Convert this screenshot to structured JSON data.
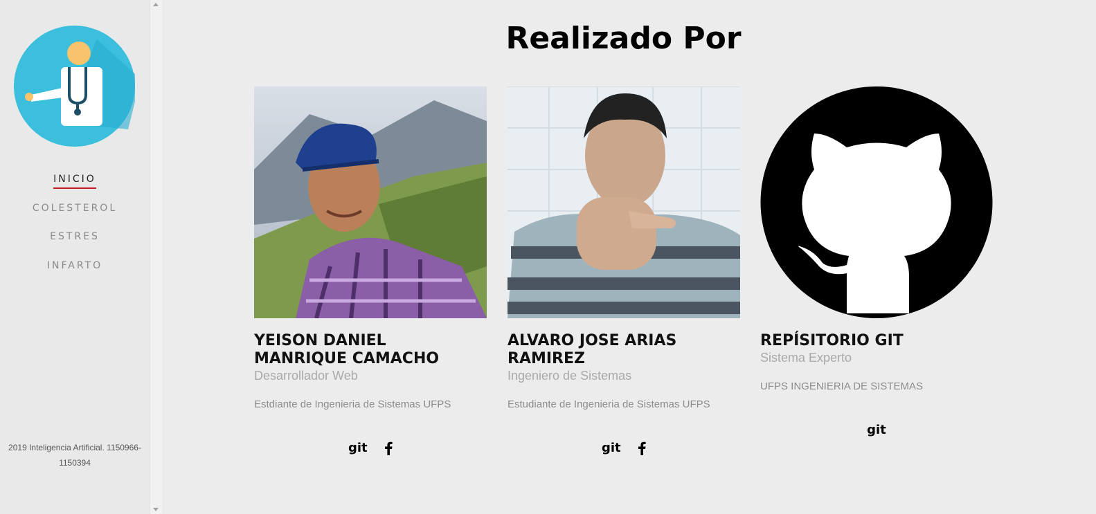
{
  "page_title": "Realizado Por",
  "nav": {
    "items": [
      {
        "label": "INICIO",
        "active": true
      },
      {
        "label": "COLESTEROL",
        "active": false
      },
      {
        "label": "ESTRES",
        "active": false
      },
      {
        "label": "INFARTO",
        "active": false
      }
    ]
  },
  "footer": {
    "line1": "2019 Inteligencia Artificial. 1150966-",
    "line2": "1150394"
  },
  "cards": [
    {
      "name_line1": "YEISON DANIEL",
      "name_line2": "MANRIQUE CAMACHO",
      "role": "Desarrollador Web",
      "description": "Estdiante de Ingenieria de Sistemas UFPS",
      "git_label": "git"
    },
    {
      "name_line1": "ALVARO JOSE ARIAS",
      "name_line2": "RAMIREZ",
      "role": "Ingeniero de Sistemas",
      "description": "Estudiante de Ingenieria de Sistemas UFPS",
      "git_label": "git"
    },
    {
      "name_line1": "REPÍSITORIO GIT",
      "role": "Sistema Experto",
      "description": "UFPS INGENIERIA DE SISTEMAS",
      "git_label": "git"
    }
  ],
  "colors": {
    "accent_underline": "#c8181e",
    "logo_circle": "#2db8d6",
    "background": "#ececec"
  }
}
